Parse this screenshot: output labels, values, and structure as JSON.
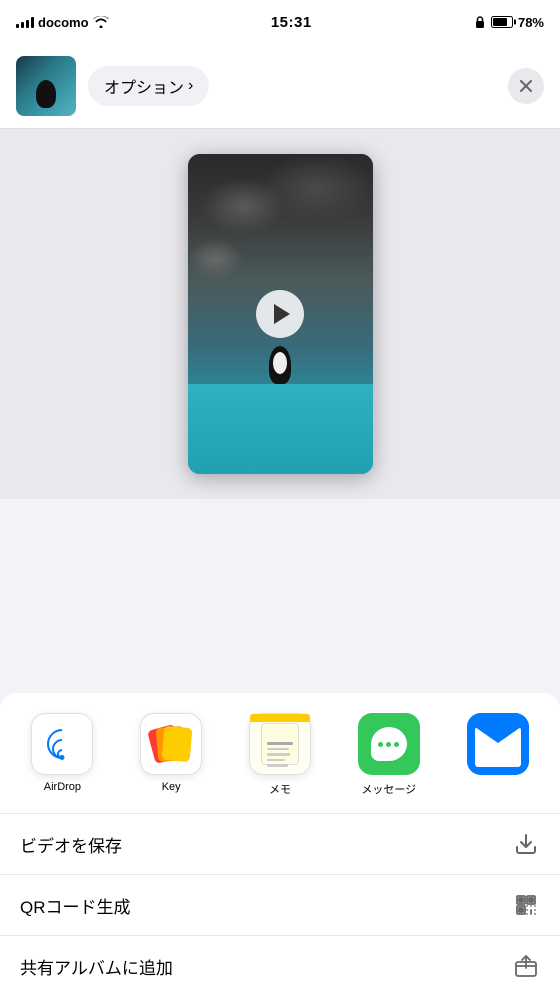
{
  "statusBar": {
    "carrier": "docomo",
    "time": "15:31",
    "battery": "78%"
  },
  "shareTop": {
    "optionsLabel": "オプション",
    "chevron": "›"
  },
  "preview": {
    "isVideo": true
  },
  "appRow": {
    "items": [
      {
        "id": "airdrop",
        "label": "AirDrop"
      },
      {
        "id": "key",
        "label": "Key"
      },
      {
        "id": "memo",
        "label": "メモ"
      },
      {
        "id": "messages",
        "label": "メッセージ"
      }
    ]
  },
  "actionList": {
    "items": [
      {
        "id": "save-video",
        "label": "ビデオを保存"
      },
      {
        "id": "qr-code",
        "label": "QRコード生成"
      },
      {
        "id": "shared-album",
        "label": "共有アルバムに追加"
      }
    ]
  }
}
